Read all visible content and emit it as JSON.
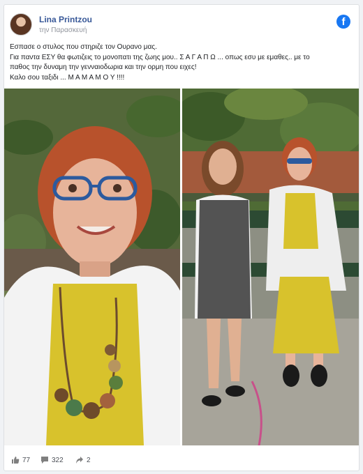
{
  "post": {
    "author": "Lina Printzou",
    "time": "την Παρασκευή",
    "platform_icon": "facebook-icon",
    "text_lines": [
      "Εσπασε ο στυλος που στηριζε τον Ουρανο μας.",
      "Για παντα ΕΣΥ θα φωτιζεις το μονοπατι της ζωης μου.. Σ Α Γ Α Π Ω ... οπως εσυ με εμαθες.. με το",
      "παθος την δυναμη την γενναιοδωρια και την ορμη που ειχες!",
      "Καλο σου ταξιδι ... Μ Α Μ Α Μ Ο Υ !!!!"
    ]
  },
  "photos": [
    {
      "description_icon": "photo-elderly-woman-portrait"
    },
    {
      "description_icon": "photo-two-women-on-bench"
    }
  ],
  "footer": {
    "likes": "77",
    "comments": "322",
    "shares": "2",
    "like_icon": "thumbs-up-icon",
    "comment_icon": "comment-icon",
    "share_icon": "share-icon"
  },
  "colors": {
    "link_blue": "#385898",
    "facebook_blue": "#1877f2",
    "background": "#f0f2f5"
  }
}
